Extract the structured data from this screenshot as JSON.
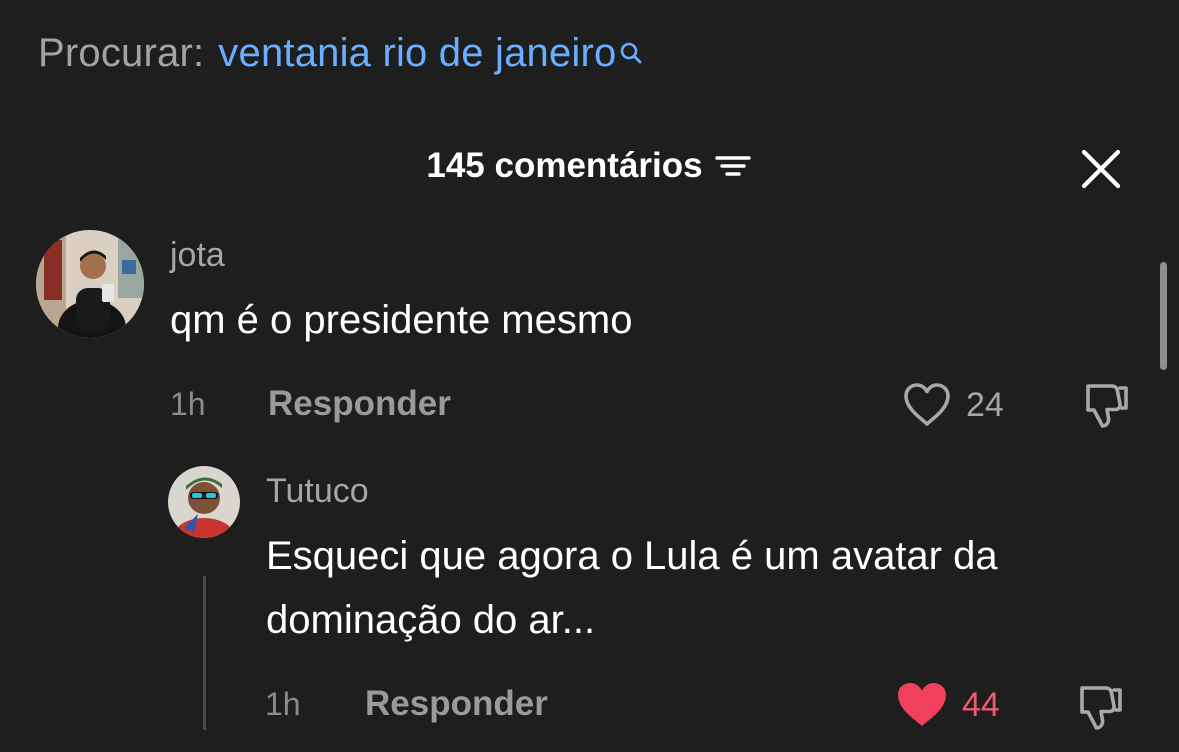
{
  "search": {
    "prefix": "Procurar:",
    "query": "ventania rio de janeiro"
  },
  "header": {
    "count_label": "145 comentários"
  },
  "icons": {
    "search": "search-icon",
    "filter": "filter-icon",
    "close": "close-icon",
    "like": "heart-icon",
    "dislike": "thumbs-down-icon"
  },
  "colors": {
    "background": "#1e1e1e",
    "link": "#6aaeff",
    "liked": "#f05a72"
  },
  "comments": [
    {
      "username": "jota",
      "text": "qm é o presidente mesmo",
      "time": "1h",
      "reply_label": "Responder",
      "likes": "24",
      "liked": false
    },
    {
      "username": "Tutuco",
      "text": "Esqueci que agora o Lula é um avatar da dominação do ar...",
      "time": "1h",
      "reply_label": "Responder",
      "likes": "44",
      "liked": true
    }
  ]
}
